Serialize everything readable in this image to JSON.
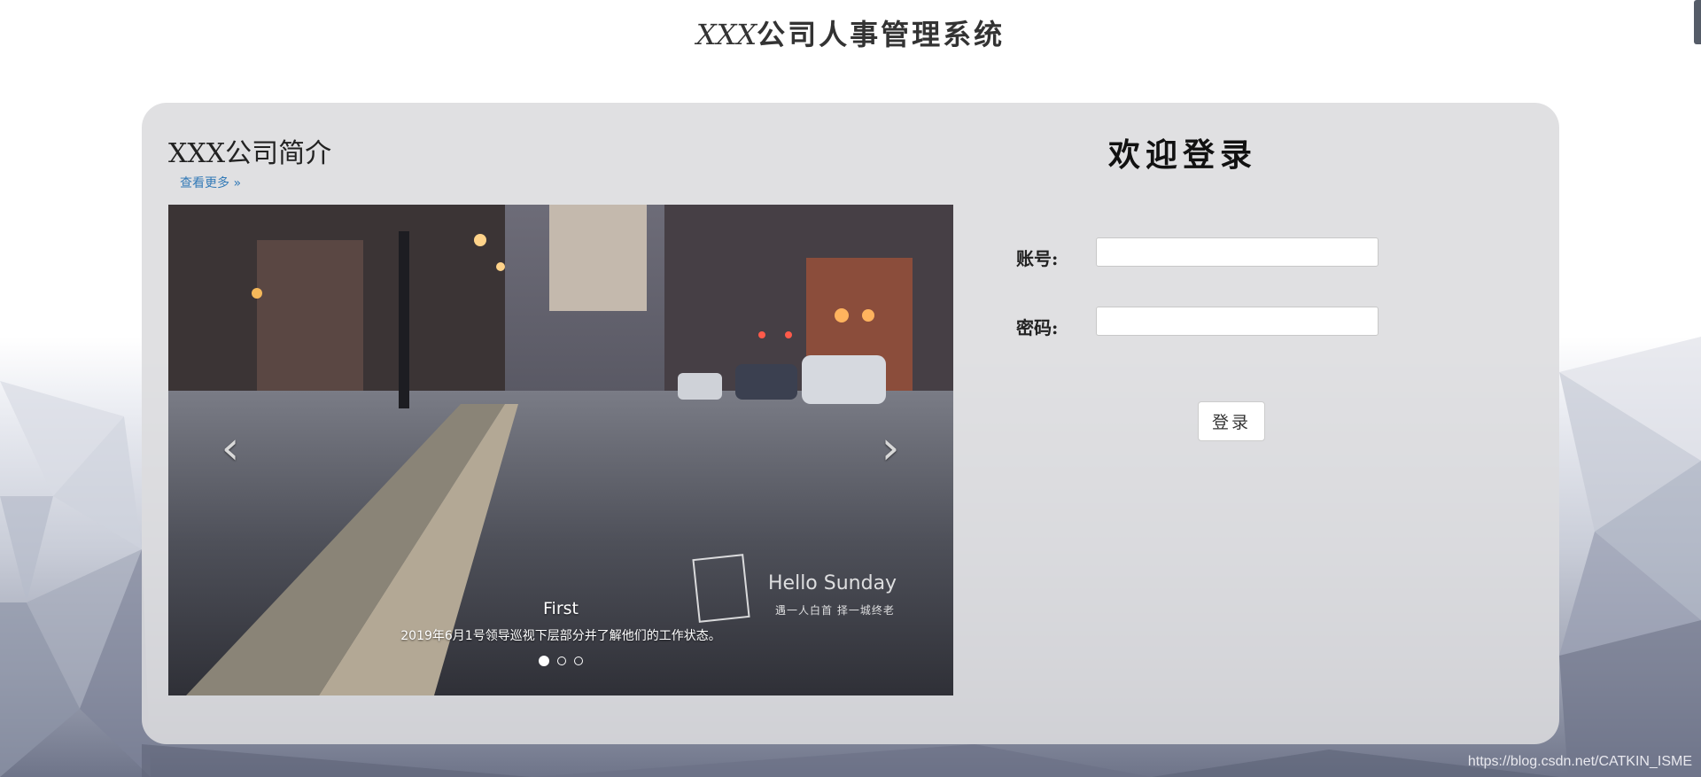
{
  "header": {
    "brand": "XXX",
    "title": "公司人事管理系统"
  },
  "intro": {
    "title": "XXX公司简介",
    "more_link": "查看更多 »"
  },
  "carousel": {
    "slide_title": "First",
    "slide_caption": "2019年6月1号领导巡视下层部分并了解他们的工作状态。",
    "prev_icon": "chevron-left-icon",
    "next_icon": "chevron-right-icon",
    "prev_glyph": "‹",
    "next_glyph": "›",
    "indicator_count": 3,
    "active_index": 0,
    "watermark_title": "Hello Sunday",
    "watermark_sub": "遇一人白首   择一城终老"
  },
  "login": {
    "title": "欢迎登录",
    "account_label": "账号:",
    "password_label": "密码:",
    "account_value": "",
    "password_value": "",
    "submit_label": "登录"
  },
  "footer": {
    "source": "https://blog.csdn.net/CATKIN_ISME"
  },
  "colors": {
    "link": "#337ab7",
    "panel": "#dcdcde"
  }
}
